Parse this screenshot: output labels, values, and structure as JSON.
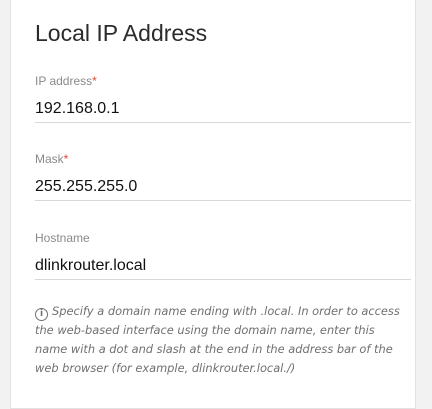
{
  "section": {
    "title": "Local IP Address"
  },
  "fields": {
    "ip_address": {
      "label": "IP address",
      "required_mark": "*",
      "value": "192.168.0.1"
    },
    "mask": {
      "label": "Mask",
      "required_mark": "*",
      "value": "255.255.255.0"
    },
    "hostname": {
      "label": "Hostname",
      "value": "dlinkrouter.local"
    }
  },
  "hint": {
    "icon": "info-icon",
    "icon_glyph": "i",
    "text": "Specify a domain name ending with .local. In order to access the web-based interface using the domain name, enter this name with a dot and slash at the end in the address bar of the web browser (for example, dlinkrouter.local./)"
  },
  "colors": {
    "required": "#e2462c",
    "label": "#8a8a8a",
    "divider": "#d8d8d8",
    "page_background": "#f2f2f2"
  }
}
